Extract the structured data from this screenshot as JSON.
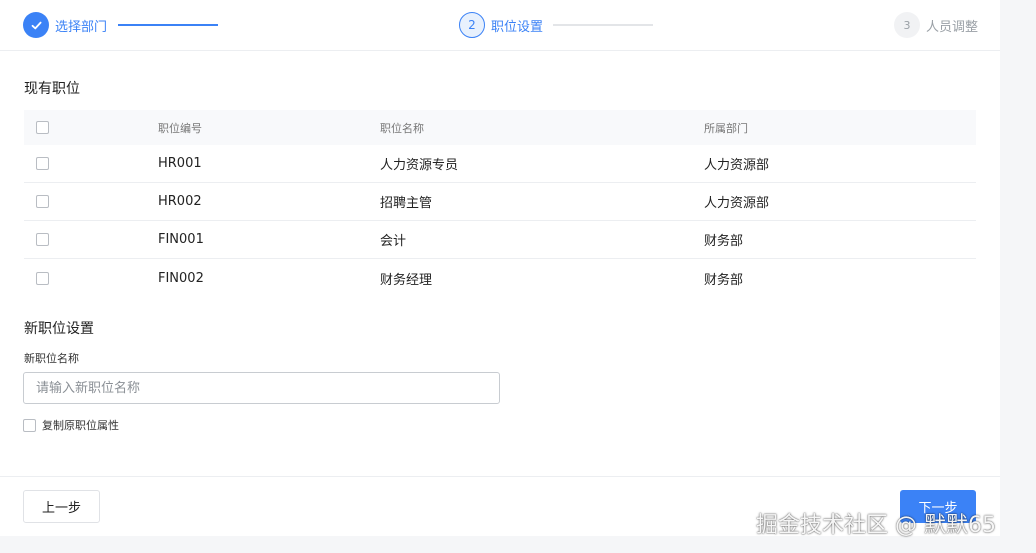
{
  "steps": [
    {
      "index": "",
      "label": "选择部门",
      "state": "done"
    },
    {
      "index": "2",
      "label": "职位设置",
      "state": "active"
    },
    {
      "index": "3",
      "label": "人员调整",
      "state": "pending"
    }
  ],
  "existing": {
    "title": "现有职位",
    "columns": [
      "职位编号",
      "职位名称",
      "所属部门"
    ],
    "rows": [
      {
        "code": "HR001",
        "name": "人力资源专员",
        "dept": "人力资源部"
      },
      {
        "code": "HR002",
        "name": "招聘主管",
        "dept": "人力资源部"
      },
      {
        "code": "FIN001",
        "name": "会计",
        "dept": "财务部"
      },
      {
        "code": "FIN002",
        "name": "财务经理",
        "dept": "财务部"
      }
    ]
  },
  "new_position": {
    "title": "新职位设置",
    "name_label": "新职位名称",
    "name_placeholder": "请输入新职位名称",
    "copy_label": "复制原职位属性"
  },
  "footer": {
    "prev_label": "上一步",
    "next_label": "下一步"
  },
  "watermark": "掘金技术社区 @ 默默65",
  "colors": {
    "accent": "#3b82f6",
    "border": "#eceef1",
    "muted": "#9aa0a6"
  }
}
